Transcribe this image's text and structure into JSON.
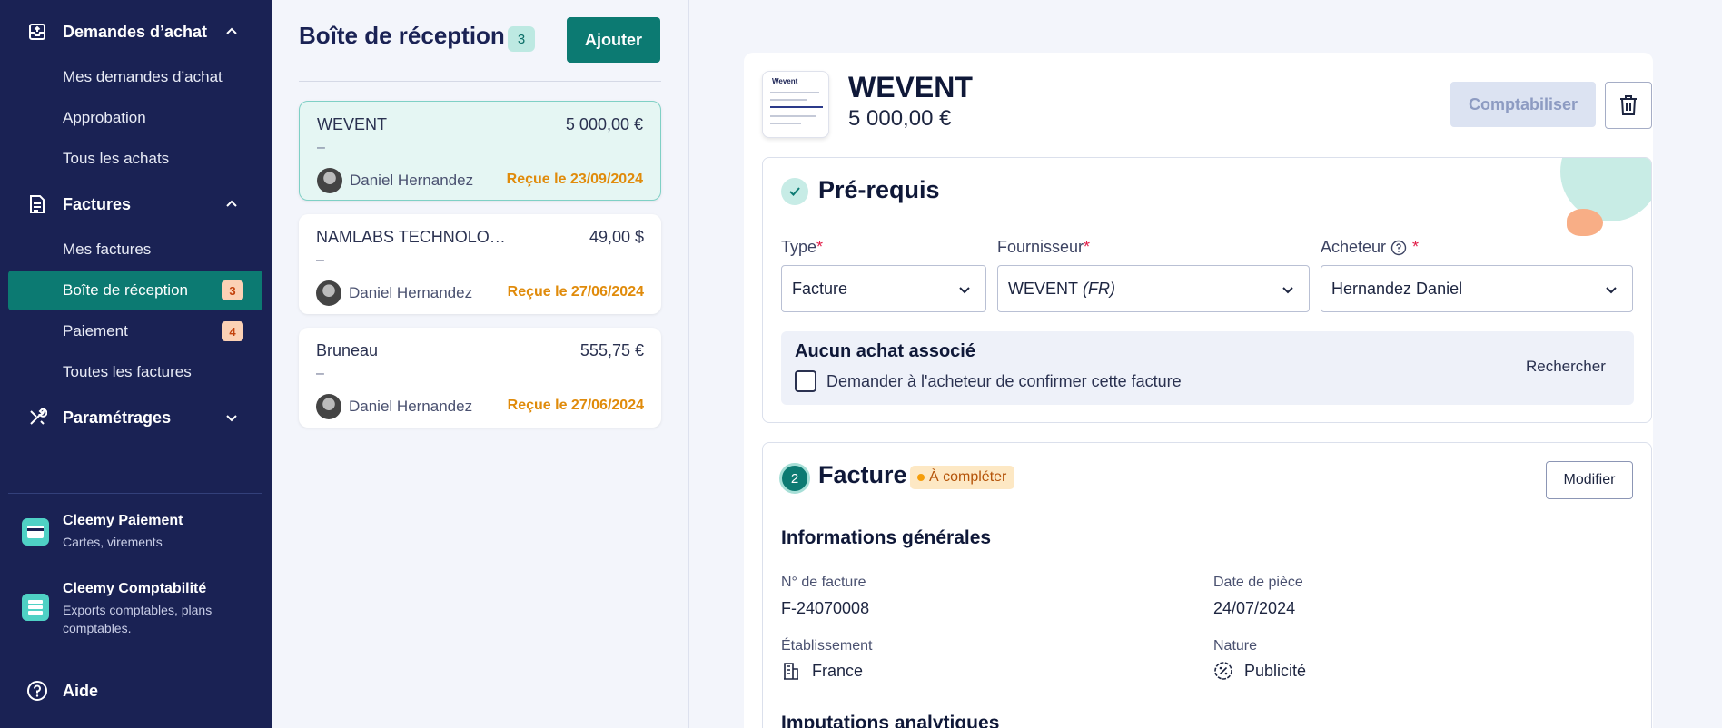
{
  "sidebar": {
    "sections": [
      {
        "label": "Demandes d’achat",
        "icon": "inbox-upload-icon",
        "expanded": true
      },
      {
        "label": "Factures",
        "icon": "document-icon",
        "expanded": true
      },
      {
        "label": "Paramétrages",
        "icon": "tools-icon",
        "expanded": false
      }
    ],
    "purchase_items": [
      "Mes demandes d’achat",
      "Approbation",
      "Tous les achats"
    ],
    "invoice_items": [
      {
        "label": "Mes factures"
      },
      {
        "label": "Boîte de réception",
        "badge": "3",
        "active": true
      },
      {
        "label": "Paiement",
        "badge": "4"
      },
      {
        "label": "Toutes les factures"
      }
    ],
    "products": [
      {
        "title": "Cleemy Paiement",
        "subtitle": "Cartes, virements"
      },
      {
        "title": "Cleemy Comptabilité",
        "subtitle": "Exports comptables, plans comptables."
      }
    ],
    "help_label": "Aide"
  },
  "inbox": {
    "title": "Boîte de réception",
    "count": "3",
    "add_label": "Ajouter",
    "cards": [
      {
        "name": "WEVENT",
        "amount": "5 000,00 €",
        "dash": "–",
        "user": "Daniel Hernandez",
        "status": "Reçue le 23/09/2024",
        "selected": true
      },
      {
        "name": "NAMLABS TECHNOLOGIES",
        "amount": "49,00 $",
        "dash": "–",
        "user": "Daniel Hernandez",
        "status": "Reçue le 27/06/2024",
        "selected": false
      },
      {
        "name": "Bruneau",
        "amount": "555,75 €",
        "dash": "–",
        "user": "Daniel Hernandez",
        "status": "Reçue le 27/06/2024",
        "selected": false
      }
    ]
  },
  "detail": {
    "thumb_logo": "Wevent",
    "title": "WEVENT",
    "amount": "5 000,00 €",
    "post_label": "Comptabiliser",
    "prereq": {
      "title": "Pré-requis",
      "type_label": "Type",
      "type_value": "Facture",
      "supplier_label": "Fournisseur",
      "supplier_value": "WEVENT",
      "supplier_country": "(FR)",
      "buyer_label": "Acheteur",
      "buyer_value": "Hernandez Daniel",
      "required_mark": "*",
      "assoc_title": "Aucun achat associé",
      "assoc_checkbox": "Demander à l'acheteur de confirmer cette facture",
      "search_label": "Rechercher"
    },
    "invoice": {
      "step": "2",
      "title": "Facture",
      "status": "À compléter",
      "edit_label": "Modifier",
      "general_title": "Informations générales",
      "number_label": "N° de facture",
      "number_value": "F-24070008",
      "date_label": "Date de pièce",
      "date_value": "24/07/2024",
      "entity_label": "Établissement",
      "entity_value": "France",
      "nature_label": "Nature",
      "nature_value": "Publicité",
      "analytics_title": "Imputations analytiques"
    }
  },
  "colors": {
    "sidebar_bg": "#1a2254",
    "accent": "#0c7a72",
    "warning": "#e08b0b"
  }
}
